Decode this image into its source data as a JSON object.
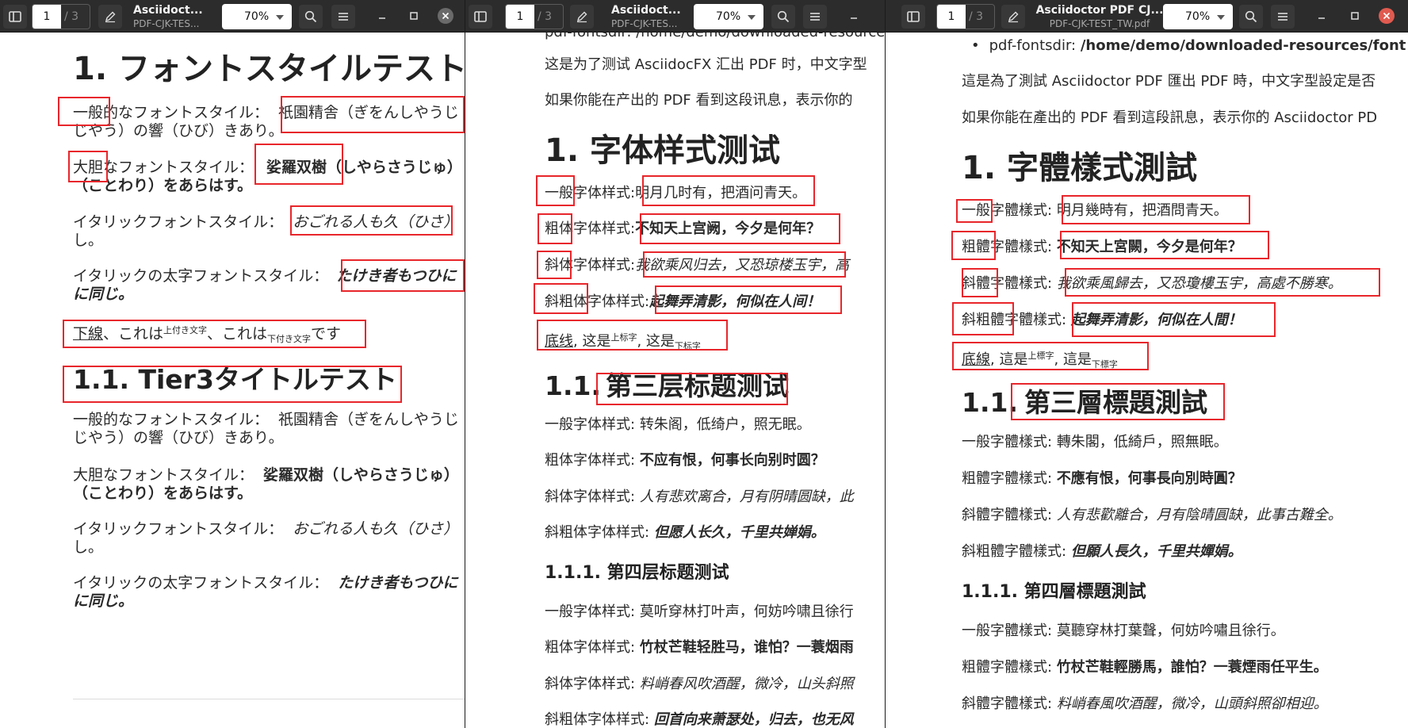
{
  "colors": {
    "accent": "#e8262b",
    "headerbar": "#2c2c2c",
    "close_button": "#e05a4f"
  },
  "icons": [
    "sidebar-icon",
    "annotate-icon",
    "search-icon",
    "menu-icon",
    "minimize-icon",
    "maximize-icon",
    "close-icon"
  ],
  "windows": [
    {
      "title": "Asciidoct...",
      "subtitle": "PDF-CJK-TES...",
      "page_current": "1",
      "page_total": "/ 3",
      "zoom": "70%"
    },
    {
      "title": "Asciidoct...",
      "subtitle": "PDF-CJK-TES...",
      "page_current": "1",
      "page_total": "/ 3",
      "zoom": "70%"
    },
    {
      "title": "Asciidoctor PDF CJ...",
      "subtitle": "PDF-CJK-TEST_TW.pdf",
      "page_current": "1",
      "page_total": "/ 3",
      "zoom": "70%"
    }
  ],
  "doc_ja": {
    "h1": "1. フォントスタイルテスト",
    "normal_label": "一般的",
    "normal_rest": "なフォントスタイル：",
    "normal_text": "祇園精舎（ぎをんしやうじ",
    "normal_cont": "じやう）の響（ひび）きあり。",
    "bold_label": "大胆",
    "bold_rest": "なフォントスタイル：",
    "bold_text": "娑羅双樹",
    "bold_text2": "（しやらさうじゅ）",
    "bold_cont": "（ことわり）をあらはす。",
    "italic_label": "イタリックフォントスタイル：",
    "italic_text": "おごれる人も久（ひさ）",
    "italic_cont": "し。",
    "bi_label": "イタリックの太字フォントスタイル：",
    "bi_text": "たけき者もつひに",
    "bi_cont": "に同じ。",
    "u_text": "下線",
    "u_mid1": "、これは",
    "u_sup": "上付き文字",
    "u_mid2": "、これは",
    "u_sub": "下付き文字",
    "u_end": "です",
    "h2": "1.1. Tier3タイトルテスト",
    "s2_normal": "一般的なフォントスタイル：",
    "s2_normal_text": "祇園精舎（ぎをんしやうじ",
    "s2_normal_cont": "じやう）の響（ひび）きあり。",
    "s2_bold": "大胆なフォントスタイル：",
    "s2_bold_text": "娑羅双樹（しやらさうじゅ）",
    "s2_bold_cont": "（ことわり）をあらはす。",
    "s2_italic": "イタリックフォントスタイル：",
    "s2_italic_text": "おごれる人も久（ひさ）",
    "s2_italic_cont": "し。",
    "s2_bi": "イタリックの太字フォントスタイル：",
    "s2_bi_text": "たけき者もつひに",
    "s2_bi_cont": "に同じ。"
  },
  "doc_sc": {
    "top": "pdf-fontsdir: /home/demo/downloaded-resources/f",
    "p1": "这是为了测试 AsciidocFX 汇出 PDF 时，中文字型",
    "p2": "如果你能在产出的 PDF 看到这段讯息，表示你的",
    "h1": "1. 字体样式测试",
    "l1a": "一般",
    "l1b": "字体样式:",
    "l1c": "明月几时有，把酒问青天。",
    "l2a": "粗体",
    "l2b": "字体样式:",
    "l2c": "不知天上宫阙，今夕是何年？",
    "l3a": "斜体",
    "l3b": "字体样式:",
    "l3c": "我欲乘风归去，又恐琼楼玉宇，高",
    "l4a": "斜粗体",
    "l4b": "字体样式:",
    "l4c": "起舞弄清影，何似在人间！",
    "l5a": "底线",
    "l5b": ", 这是",
    "l5sup": "上标字",
    "l5c": ", 这是",
    "l5sub": "下标字",
    "h2a": "1.1.",
    "h2b": "第三层标题测试",
    "s1": "一般字体样式:",
    "s1t": "转朱阁，低绮户，照无眠。",
    "s2": "粗体字体样式:",
    "s2t": "不应有恨，何事长向别时圆？",
    "s3": "斜体字体样式:",
    "s3t": "人有悲欢离合，月有阴晴圆缺，此",
    "s4": "斜粗体字体样式:",
    "s4t": "但愿人长久，千里共婵娟。",
    "h3": "1.1.1. 第四层标题测试",
    "t1": "一般字体样式:",
    "t1t": "莫听穿林打叶声，何妨吟啸且徐行",
    "t2": "粗体字体样式:",
    "t2t": "竹杖芒鞋轻胜马，谁怕？一蓑烟雨",
    "t3": "斜体字体样式:",
    "t3t": "料峭春风吹酒醒，微冷，山头斜照",
    "t4": "斜粗体字体样式:",
    "t4t": "回首向来萧瑟处，归去，也无风"
  },
  "doc_tc": {
    "top_a": "pdf-fontsdir:",
    "top_b": "/home/demo/downloaded-resources/font",
    "p1": "這是為了測試 Asciidoctor PDF 匯出 PDF 時，中文字型設定是否",
    "p2": "如果你能在產出的 PDF 看到這段訊息，表示你的 Asciidoctor PD",
    "h1": "1. 字體樣式測試",
    "l1a": "一般",
    "l1b": "字體樣式:",
    "l1c": "明月幾時有，把酒問青天。",
    "l2a": "粗體",
    "l2b": "字體樣式:",
    "l2c": "不知天上宮闕，今夕是何年？",
    "l3a": "斜體",
    "l3b": "字體樣式:",
    "l3c": "我欲乘風歸去，又恐瓊樓玉宇，高處不勝寒。",
    "l4a": "斜粗體",
    "l4b": "字體樣式:",
    "l4c": "起舞弄清影，何似在人間！",
    "l5a": "底線",
    "l5b": ", 這是",
    "l5sup": "上標字",
    "l5c": ", 這是",
    "l5sub": "下標字",
    "h2a": "1.1.",
    "h2b": "第三層標題測試",
    "s1": "一般字體樣式:",
    "s1t": "轉朱閣，低綺戶，照無眠。",
    "s2": "粗體字體樣式:",
    "s2t": "不應有恨，何事長向別時圓？",
    "s3": "斜體字體樣式:",
    "s3t": "人有悲歡離合，月有陰晴圓缺，此事古難全。",
    "s4": "斜粗體字體樣式:",
    "s4t": "但願人長久，千里共嬋娟。",
    "h3": "1.1.1. 第四層標題測試",
    "t1": "一般字體樣式:",
    "t1t": "莫聽穿林打葉聲，何妨吟嘯且徐行。",
    "t2": "粗體字體樣式:",
    "t2t": "竹杖芒鞋輕勝馬，誰怕？一蓑煙雨任平生。",
    "t3": "斜體字體樣式:",
    "t3t": "料峭春風吹酒醒，微冷，山頭斜照卻相迎。"
  }
}
